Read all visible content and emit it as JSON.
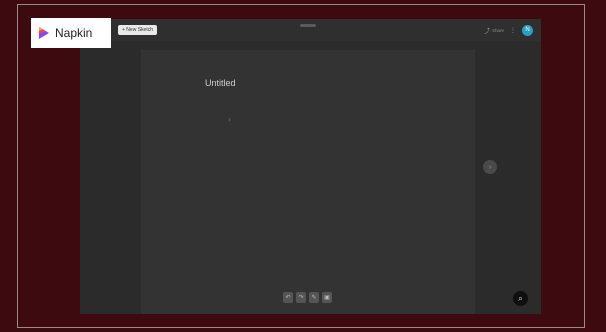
{
  "brand": {
    "name": "Napkin",
    "accent_colors": [
      "#f6a623",
      "#e8405f",
      "#8a46ff"
    ]
  },
  "toolbar": {
    "new_sketch_label": "+ New Sketch",
    "share_label": "Share",
    "menu_icon": "kebab-icon",
    "avatar_initial": "N"
  },
  "document": {
    "title": "Untitled"
  },
  "colors": {
    "outer_background": "#3d0b0f",
    "app_background": "#2b2b2b",
    "canvas": "#333333",
    "avatar": "#2e9cc3"
  }
}
